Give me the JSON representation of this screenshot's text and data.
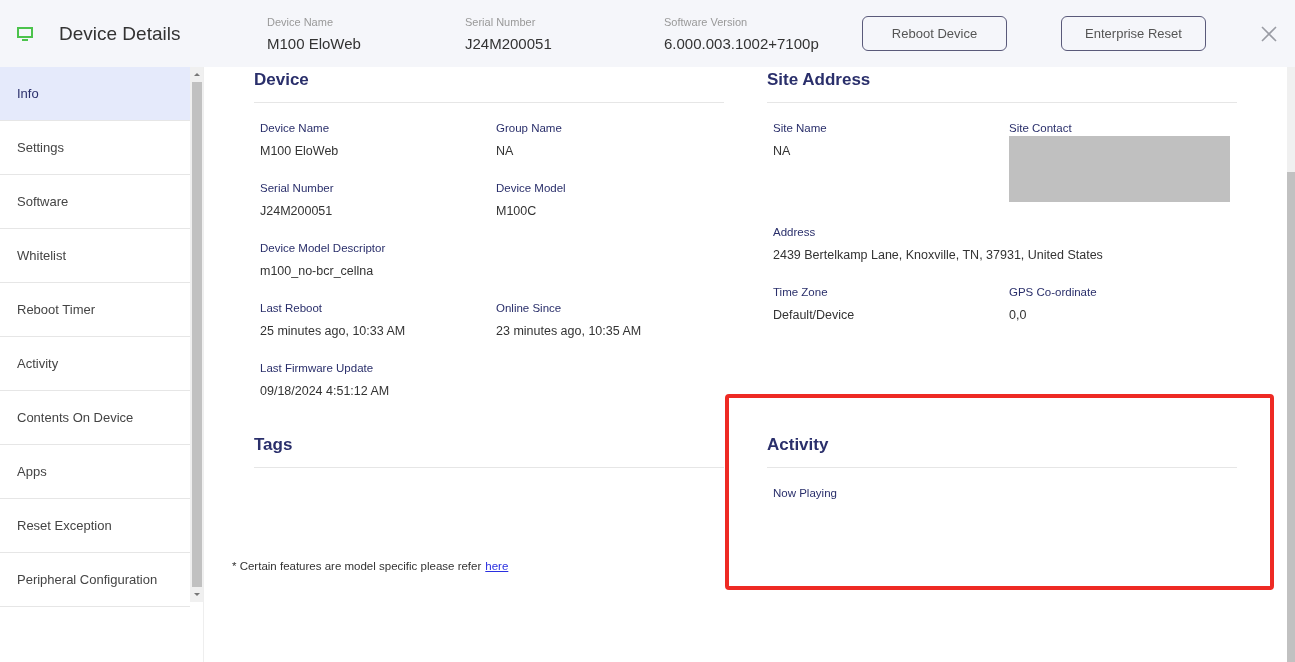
{
  "header": {
    "title": "Device Details",
    "info": [
      {
        "label": "Device Name",
        "value": "M100 EloWeb"
      },
      {
        "label": "Serial Number",
        "value": "J24M200051"
      },
      {
        "label": "Software Version",
        "value": "6.000.003.1002+7100p"
      }
    ],
    "buttons": [
      "Reboot Device",
      "Enterprise Reset"
    ]
  },
  "sidebar": {
    "items": [
      {
        "label": "Info",
        "selected": true
      },
      {
        "label": "Settings",
        "selected": false
      },
      {
        "label": "Software",
        "selected": false
      },
      {
        "label": "Whitelist",
        "selected": false
      },
      {
        "label": "Reboot Timer",
        "selected": false
      },
      {
        "label": "Activity",
        "selected": false
      },
      {
        "label": "Contents On Device",
        "selected": false
      },
      {
        "label": "Apps",
        "selected": false
      },
      {
        "label": "Reset Exception",
        "selected": false
      },
      {
        "label": "Peripheral Configuration",
        "selected": false
      }
    ]
  },
  "sections": [
    {
      "title": "Device",
      "fields": [
        {
          "label": "Device Name",
          "value": "M100 EloWeb",
          "kind": "text",
          "wide": false
        },
        {
          "label": "Group Name",
          "value": "NA",
          "kind": "text",
          "wide": false
        },
        {
          "label": "Serial Number",
          "value": "J24M200051",
          "kind": "text",
          "wide": false
        },
        {
          "label": "Device Model",
          "value": "M100C",
          "kind": "text",
          "wide": false
        },
        {
          "label": "Device Model Descriptor",
          "value": "m100_no-bcr_cellna",
          "kind": "text",
          "wide": true
        },
        {
          "label": "Last Reboot",
          "value": "25 minutes ago, 10:33 AM",
          "kind": "text",
          "wide": false
        },
        {
          "label": "Online Since",
          "value": "23 minutes ago, 10:35 AM",
          "kind": "text",
          "wide": false
        },
        {
          "label": "Last Firmware Update",
          "value": "09/18/2024 4:51:12 AM",
          "kind": "text",
          "wide": false
        }
      ],
      "highlighted": false
    },
    {
      "title": "Site Address",
      "fields": [
        {
          "label": "Site Name",
          "value": "NA",
          "kind": "text",
          "wide": false
        },
        {
          "label": "Site Contact",
          "kind": "redacted",
          "wide": false
        },
        {
          "label": "Address",
          "value": "2439 Bertelkamp Lane, Knoxville, TN, 37931, United States",
          "kind": "text",
          "wide": true
        },
        {
          "label": "Time Zone",
          "value": "Default/Device",
          "kind": "text",
          "wide": false
        },
        {
          "label": "GPS Co-ordinate",
          "value": "0,0",
          "kind": "text",
          "wide": false
        }
      ],
      "highlighted": false
    },
    {
      "title": "Tags",
      "highlighted": false
    },
    {
      "title": "Activity",
      "fields": [
        {
          "label": "Now Playing",
          "kind": "label",
          "wide": false
        }
      ],
      "highlighted": true
    }
  ],
  "footnote": {
    "text": "* Certain features are model specific please refer",
    "link": "here"
  }
}
